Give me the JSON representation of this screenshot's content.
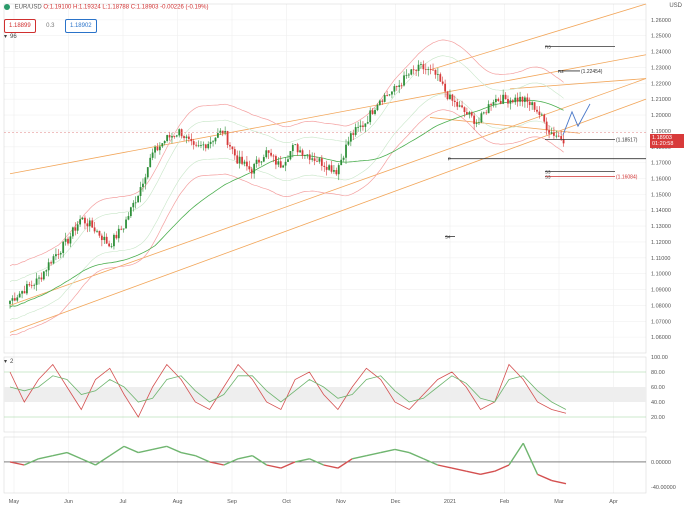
{
  "header": {
    "symbol": "EUR/USD",
    "ohlc": "O:1.19100 H:1.19324 L:1.18788 C:1.18903 -0.00226 (-0.19%)",
    "sell": "1.18899",
    "spread": "0.3",
    "buy": "1.18902",
    "currency": "USD",
    "indicator_main": "96",
    "indicator_1": "2",
    "price_tag_1": "1.18903",
    "price_tag_2": "01:20:58"
  },
  "colors": {
    "bull": "#2f8f3a",
    "bear": "#d63b3b",
    "channel": "#f2a65a",
    "bollinger": "#f4a0a0",
    "ma_green": "#4caf50",
    "stoch_k": "#d45050",
    "stoch_d": "#6fb56f"
  },
  "chart_data": [
    {
      "type": "line",
      "title": "",
      "x": [
        "May",
        "Jun",
        "Jul",
        "Aug",
        "Sep",
        "Oct",
        "Nov",
        "Dec",
        "2021",
        "Feb",
        "Mar",
        "Apr"
      ],
      "ylim": [
        1.05,
        1.27
      ],
      "yticks": [
        "1.26000",
        "1.25000",
        "1.24000",
        "1.23000",
        "1.22000",
        "1.21000",
        "1.20000",
        "1.19000",
        "1.18000",
        "1.17000",
        "1.16000",
        "1.15000",
        "1.14000",
        "1.13000",
        "1.12000",
        "1.11000",
        "1.10000",
        "1.09000",
        "1.08000",
        "1.07000",
        "1.06000"
      ],
      "levels": [
        {
          "name": "R3",
          "value": 1.2432
        },
        {
          "name": "R2",
          "value": 1.2278,
          "price_label": "1.22454"
        },
        {
          "name": "P",
          "value": 1.1725
        },
        {
          "name": "S3",
          "value": 1.1645
        },
        {
          "name": "S3",
          "value": 1.1612,
          "price_label": "1.16084"
        },
        {
          "name": "S4",
          "value": 1.1235
        },
        {
          "name": "",
          "value": 1.1845,
          "price_label": "1.18517"
        }
      ],
      "series": [
        {
          "values": [
            1.083,
            1.09,
            1.096,
            1.11,
            1.12,
            1.135,
            1.128,
            1.118,
            1.13,
            1.15,
            1.175,
            1.185,
            1.19,
            1.178,
            1.183,
            1.19,
            1.172,
            1.165,
            1.177,
            1.168,
            1.18,
            1.175,
            1.17,
            1.165,
            1.187,
            1.195,
            1.21,
            1.215,
            1.225,
            1.23,
            1.225,
            1.21,
            1.202,
            1.195,
            1.21,
            1.21,
            1.21,
            1.205,
            1.19,
            1.185
          ]
        }
      ]
    },
    {
      "type": "line",
      "title": "",
      "ylim": [
        0,
        100
      ],
      "yticks": [
        "100.00",
        "80.00",
        "60.00",
        "40.00",
        "20.00"
      ],
      "levels": [
        80,
        20
      ],
      "series": [
        {
          "values": [
            80,
            40,
            70,
            90,
            60,
            30,
            70,
            85,
            50,
            20,
            60,
            90,
            70,
            40,
            30,
            60,
            90,
            70,
            40,
            30,
            70,
            80,
            50,
            30,
            60,
            85,
            70,
            40,
            30,
            50,
            70,
            80,
            60,
            30,
            40,
            90,
            70,
            40,
            30,
            25
          ]
        },
        {
          "values": [
            60,
            55,
            60,
            75,
            70,
            50,
            55,
            70,
            60,
            40,
            45,
            70,
            75,
            55,
            40,
            50,
            75,
            75,
            55,
            40,
            55,
            70,
            60,
            45,
            50,
            70,
            75,
            55,
            40,
            45,
            60,
            75,
            65,
            45,
            40,
            70,
            75,
            55,
            40,
            30
          ]
        }
      ]
    },
    {
      "type": "line",
      "title": "",
      "ylim": [
        -50,
        40
      ],
      "yticks": [
        "0.00000",
        "-40.00000"
      ],
      "levels": [
        0
      ],
      "series": [
        {
          "values": [
            0,
            -5,
            5,
            10,
            15,
            5,
            -5,
            10,
            25,
            15,
            20,
            25,
            15,
            10,
            0,
            -5,
            5,
            10,
            -5,
            -10,
            0,
            5,
            -5,
            -10,
            5,
            10,
            15,
            20,
            15,
            5,
            -5,
            -10,
            -15,
            -20,
            -15,
            -5,
            30,
            -20,
            -30,
            -35
          ]
        }
      ]
    }
  ]
}
